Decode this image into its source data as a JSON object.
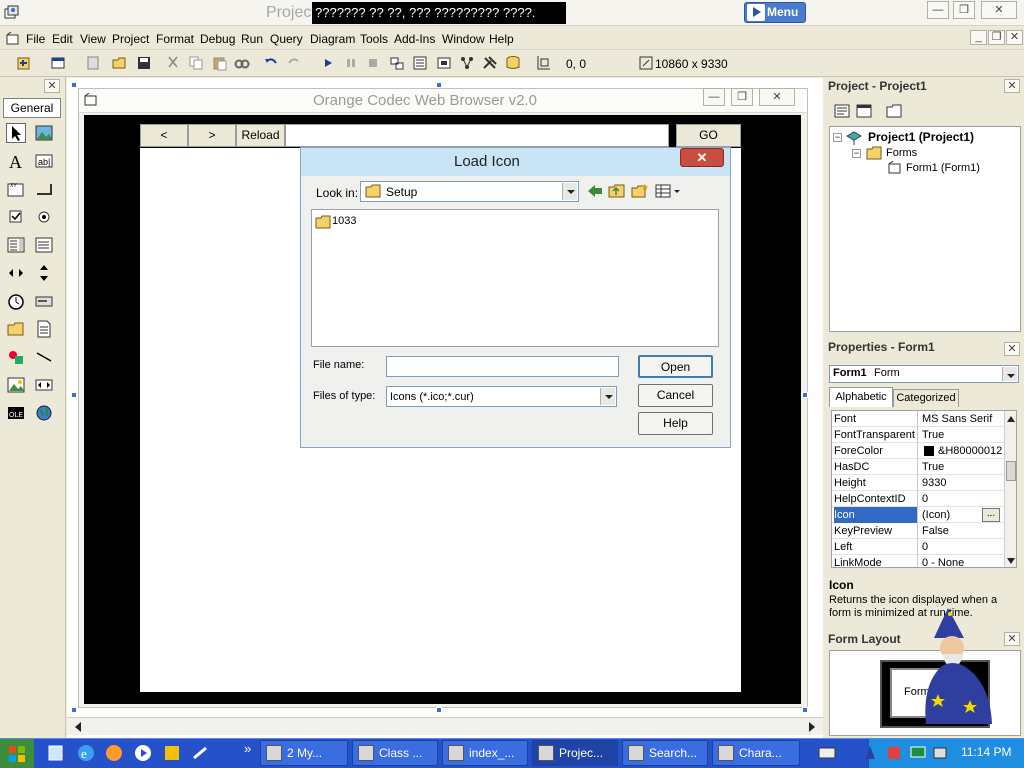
{
  "window": {
    "title_prefix": "Project",
    "overlay_text": "??????? ?? ??, ??? ????????? ????.",
    "menu_button": "Menu",
    "minimize": "—",
    "restore": "❐",
    "close": "✕"
  },
  "menubar": {
    "items": [
      "File",
      "Edit",
      "View",
      "Project",
      "Format",
      "Debug",
      "Run",
      "Query",
      "Diagram",
      "Tools",
      "Add-Ins",
      "Window",
      "Help"
    ]
  },
  "toolbar": {
    "position_text": "0, 0",
    "size_text": "10860 x 9330"
  },
  "toolbox": {
    "tab_label": "General"
  },
  "form": {
    "title": "Orange Codec Web Browser v2.0",
    "back_label": "<",
    "forward_label": ">",
    "reload_label": "Reload",
    "go_label": "GO",
    "url_value": ""
  },
  "dialog": {
    "title": "Load Icon",
    "close_label": "✕",
    "look_in_label": "Look in:",
    "look_in_value": "Setup",
    "files": [
      "1033"
    ],
    "file_name_label": "File name:",
    "file_name_value": "",
    "files_of_type_label": "Files of type:",
    "files_of_type_value": "Icons (*.ico;*.cur)",
    "open_label": "Open",
    "cancel_label": "Cancel",
    "help_label": "Help"
  },
  "project_panel": {
    "title": "Project - Project1",
    "root": "Project1 (Project1)",
    "folder": "Forms",
    "item": "Form1 (Form1)"
  },
  "properties_panel": {
    "title": "Properties - Form1",
    "object_name": "Form1",
    "object_type": "Form",
    "tab_alphabetic": "Alphabetic",
    "tab_categorized": "Categorized",
    "rows": [
      {
        "k": "Font",
        "v": "MS Sans Serif"
      },
      {
        "k": "FontTransparent",
        "v": "True"
      },
      {
        "k": "ForeColor",
        "v": "&H80000012"
      },
      {
        "k": "HasDC",
        "v": "True"
      },
      {
        "k": "Height",
        "v": "9330"
      },
      {
        "k": "HelpContextID",
        "v": "0"
      },
      {
        "k": "Icon",
        "v": "(Icon)"
      },
      {
        "k": "KeyPreview",
        "v": "False"
      },
      {
        "k": "Left",
        "v": "0"
      },
      {
        "k": "LinkMode",
        "v": "0 - None"
      }
    ],
    "selected_row": "Icon",
    "desc_title": "Icon",
    "desc_text": "Returns the icon displayed when a form is minimized at run time."
  },
  "layout_panel": {
    "title": "Form Layout",
    "preview_label": "Form"
  },
  "taskbar": {
    "tasks": [
      "2 My...",
      "Class ...",
      "index_...",
      "Projec...",
      "Search...",
      "Chara..."
    ],
    "active_index": 3,
    "clock": "11:14 PM"
  },
  "colors": {
    "accent": "#316ac5",
    "taskbar": "#2552c8",
    "dialog_title": "#c9e4f5"
  }
}
